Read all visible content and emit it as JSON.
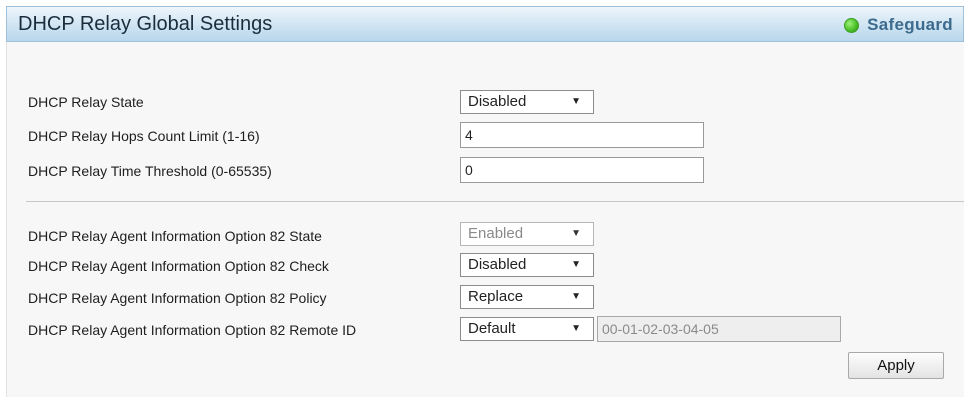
{
  "header": {
    "title": "DHCP Relay Global Settings",
    "safeguard_label": "Safeguard",
    "safeguard_color": "#4cc22a"
  },
  "settings": {
    "relay_state": {
      "label": "DHCP Relay State",
      "value": "Disabled"
    },
    "hops_count": {
      "label": "DHCP Relay Hops Count Limit (1-16)",
      "value": "4"
    },
    "time_threshold": {
      "label": "DHCP Relay Time Threshold (0-65535)",
      "value": "0"
    }
  },
  "option82": {
    "state": {
      "label": "DHCP Relay Agent Information Option 82 State",
      "value": "Enabled"
    },
    "check": {
      "label": "DHCP Relay Agent Information Option 82 Check",
      "value": "Disabled"
    },
    "policy": {
      "label": "DHCP Relay Agent Information Option 82 Policy",
      "value": "Replace"
    },
    "remote_id": {
      "label": "DHCP Relay Agent Information Option 82 Remote ID",
      "value": "Default",
      "mac": "00-01-02-03-04-05"
    }
  },
  "buttons": {
    "apply": "Apply"
  }
}
